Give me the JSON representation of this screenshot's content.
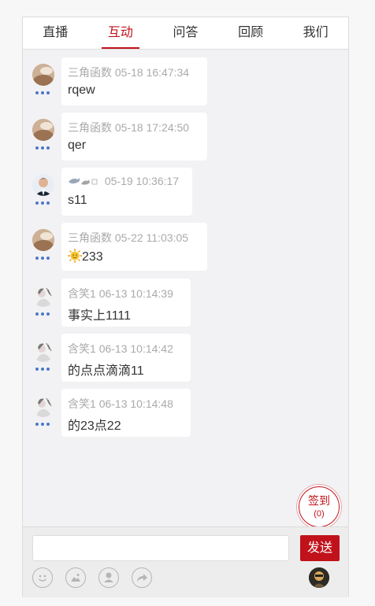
{
  "tabs": [
    {
      "label": "直播"
    },
    {
      "label": "互动"
    },
    {
      "label": "问答"
    },
    {
      "label": "回顾"
    },
    {
      "label": "我们"
    }
  ],
  "active_tab": "互动",
  "messages": [
    {
      "user": "三角函数",
      "time": "05-18 16:47:34",
      "text": "rqew",
      "avatar": "photo-avatar"
    },
    {
      "user": "三角函数",
      "time": "05-18 17:24:50",
      "text": "qer",
      "avatar": "photo-avatar"
    },
    {
      "user": "",
      "time": "05-19 10:36:17",
      "text": "s11",
      "avatar": "man-suit-avatar",
      "name_icons": "dolphin-emoji"
    },
    {
      "user": "三角函数",
      "time": "05-22 11:03:05",
      "text": "233",
      "avatar": "photo-avatar",
      "text_icon": "sun-emoji"
    },
    {
      "user": "含笑1",
      "time": "06-13 10:14:39",
      "text": "事实上1111",
      "avatar": "sketch-avatar"
    },
    {
      "user": "含笑1",
      "time": "06-13 10:14:42",
      "text": "的点点滴滴11",
      "avatar": "sketch-avatar"
    },
    {
      "user": "含笑1",
      "time": "06-13 10:14:48",
      "text": "的23点22",
      "avatar": "sketch-avatar"
    }
  ],
  "signin": {
    "label": "签到",
    "count": "(0)"
  },
  "composer": {
    "value": "",
    "send_label": "发送"
  },
  "toolbar_icons": [
    "smiley-icon",
    "image-icon",
    "person-icon",
    "share-icon"
  ],
  "colors": {
    "accent": "#c1121b",
    "dots": "#4a78c8"
  }
}
